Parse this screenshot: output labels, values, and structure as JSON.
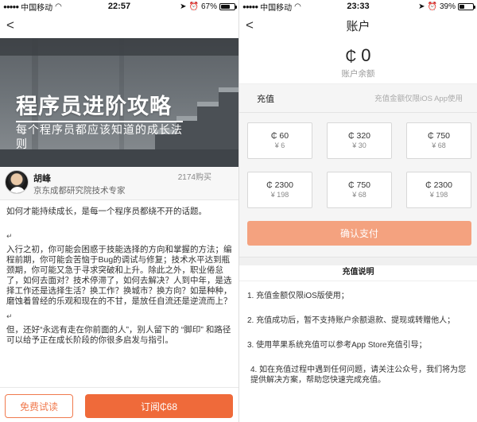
{
  "left": {
    "status": {
      "carrier": "中国移动",
      "time": "22:57",
      "battery": "67%",
      "battery_level": 0.67
    },
    "nav": {
      "back": "<"
    },
    "hero": {
      "title_a": "程序员",
      "title_b": "进阶攻略",
      "subtitle": "每个程序员都应该知道的成长法则"
    },
    "author": {
      "name": "胡峰",
      "role": "京东成都研究院技术专家",
      "buys": "2174购买"
    },
    "article": {
      "p1": "如何才能持续成长，是每一个程序员都绕不开的话题。",
      "mark": "↵",
      "p2": "入行之初，你可能会困惑于技能选择的方向和掌握的方法；编程前期，你可能会苦恼于Bug的调试与修复；技术水平达到瓶颈期，你可能又急于寻求突破和上升。除此之外，职业倦怠了，如何去面对？技术停滞了，如何去解决？人到中年，是选择工作还是选择生活？换工作？换城市？换方向？如是种种，磨蚀着曾经的乐观和现在的不甘，是放任自流还是逆流而上？",
      "p3": "但，还好“永远有走在你前面的人”，别人留下的 “脚印” 和路径可以给予正在成长阶段的你很多启发与指引。"
    },
    "buttons": {
      "trial": "免费试读",
      "subscribe": "订阅₵68"
    }
  },
  "right": {
    "status": {
      "carrier": "中国移动",
      "time": "23:33",
      "battery": "39%",
      "battery_level": 0.39
    },
    "nav": {
      "back": "<",
      "title": "账户"
    },
    "balance": {
      "symbol": "₵",
      "value": "0",
      "label": "账户余额"
    },
    "recharge": {
      "label": "充值",
      "note": "充值金额仅限iOS App使用"
    },
    "options": [
      {
        "amount": "₵ 60",
        "price": "¥ 6"
      },
      {
        "amount": "₵ 320",
        "price": "¥ 30"
      },
      {
        "amount": "₵ 750",
        "price": "¥ 68"
      },
      {
        "amount": "₵ 2300",
        "price": "¥ 198"
      },
      {
        "amount": "₵ 750",
        "price": "¥ 68"
      },
      {
        "amount": "₵ 2300",
        "price": "¥ 198"
      }
    ],
    "pay_button": "确认支付",
    "explain": {
      "title": "充值说明",
      "rules": [
        "1. 充值金额仅限iOS版使用；",
        "2. 充值成功后，暂不支持账户余额退款、提现或转赠他人；",
        "3. 使用苹果系统充值可以参考App Store充值引导；",
        "4. 如在充值过程中遇到任何问题，请关注公众号，我们将为您提供解决方案，帮助您快速完成充值。"
      ]
    }
  }
}
